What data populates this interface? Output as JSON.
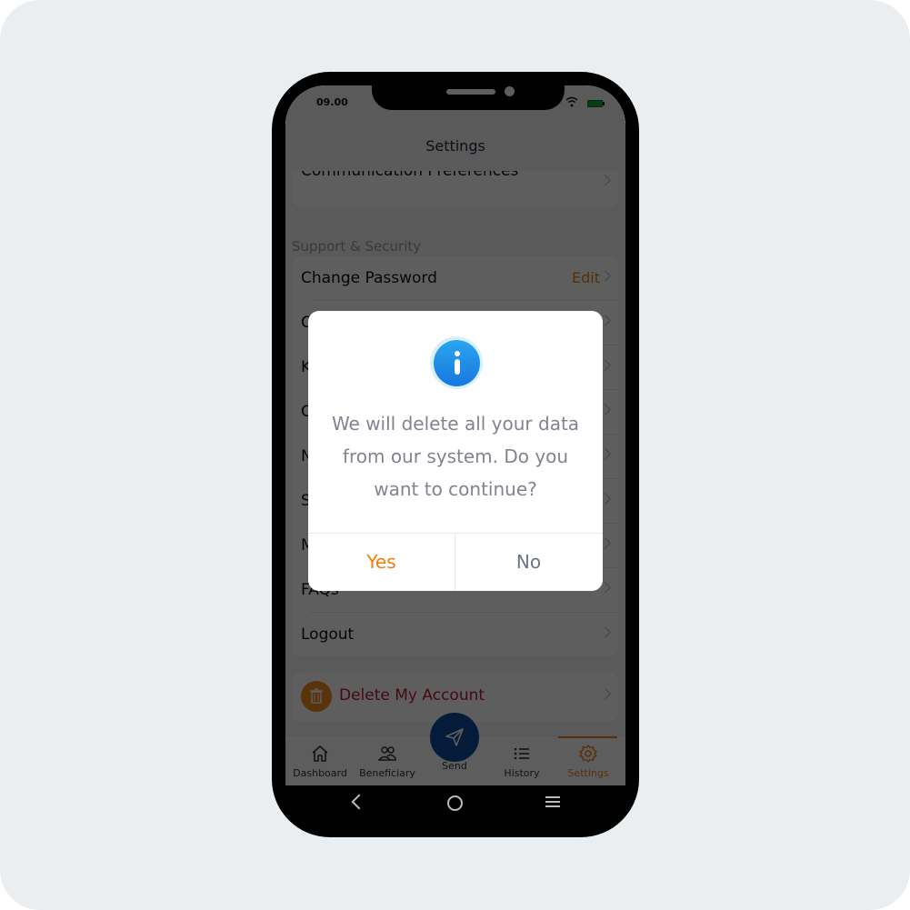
{
  "status_bar": {
    "time": "09.00",
    "icons": [
      "wifi-icon",
      "battery-icon"
    ]
  },
  "header": {
    "title": "Settings"
  },
  "settings": {
    "partial_item": {
      "label": "Communication Preferences"
    },
    "section_title": "Support & Security",
    "items": [
      {
        "label": "Change Password",
        "action": "Edit"
      },
      {
        "label": "C"
      },
      {
        "label": "K"
      },
      {
        "label": "C"
      },
      {
        "label": "N"
      },
      {
        "label": "S"
      },
      {
        "label": "M"
      },
      {
        "label": "FAQs"
      },
      {
        "label": "Logout"
      }
    ],
    "delete_account": {
      "label": "Delete My Account",
      "icon": "trash-icon"
    }
  },
  "tabbar": {
    "tabs": [
      {
        "label": "Dashboard",
        "icon": "home-icon"
      },
      {
        "label": "Beneficiary",
        "icon": "users-icon"
      },
      {
        "label": "Send",
        "icon": "send-icon"
      },
      {
        "label": "History",
        "icon": "list-icon"
      },
      {
        "label": "Settings",
        "icon": "gear-icon",
        "active": true
      }
    ]
  },
  "dialog": {
    "icon": "info-icon",
    "message": "We will delete all your data from our system. Do you want to continue?",
    "yes_label": "Yes",
    "no_label": "No"
  },
  "colors": {
    "accent": "#e8831a",
    "danger": "#c0173b",
    "send_fab": "#0b4a9a",
    "info": "#1f8fe8"
  }
}
